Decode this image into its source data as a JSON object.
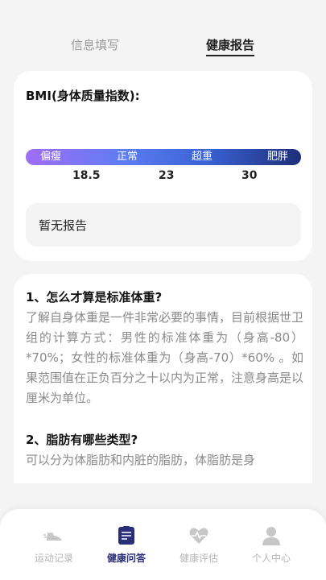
{
  "tabs": [
    {
      "label": "信息填写",
      "active": false
    },
    {
      "label": "健康报告",
      "active": true
    }
  ],
  "bmi": {
    "title": "BMI(身体质量指数):",
    "segments": [
      "偏瘦",
      "正常",
      "超重",
      "肥胖"
    ],
    "thresholds": [
      "18.5",
      "23",
      "30"
    ],
    "report": "暂无报告"
  },
  "qa": [
    {
      "question": "1、怎么才算是标准体重?",
      "answer": "了解自身体重是一件非常必要的事情，目前根据世卫组的计算方式：男性的标准体重为（身高-80）*70%；女性的标准体重为（身高-70）*60% 。如果范围值在正负百分之十以内为正常，注意身高是以厘米为单位。"
    },
    {
      "question": "2、脂肪有哪些类型?",
      "answer": "可以分为体脂肪和内脏的脂肪，体脂肪是身"
    }
  ],
  "nav": [
    {
      "label": "运动记录",
      "icon": "running-shoe-icon",
      "active": false
    },
    {
      "label": "健康问答",
      "icon": "clipboard-icon",
      "active": true
    },
    {
      "label": "健康评估",
      "icon": "heartbeat-icon",
      "active": false
    },
    {
      "label": "个人中心",
      "icon": "person-icon",
      "active": false
    }
  ],
  "colors": {
    "accent": "#2a2f78",
    "inactive": "#b5b5b5",
    "bar_start": "#a16df6",
    "bar_end": "#1e2f78"
  }
}
